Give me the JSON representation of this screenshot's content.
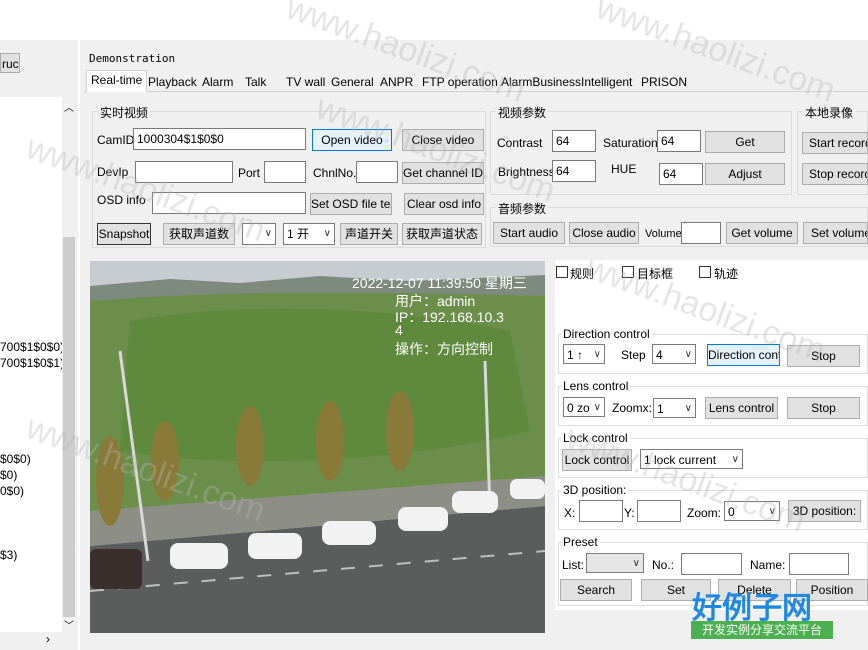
{
  "left_panel": {
    "top_button": "ruc",
    "list_items": [
      "700$1$0$0)",
      "700$1$0$1)",
      "$0$0)",
      "$0)",
      "0$0)",
      "$3)"
    ]
  },
  "window_title": "Demonstration",
  "tabs": [
    "Real-time",
    "Playback",
    "Alarm",
    "Talk",
    "TV wall",
    "General",
    "ANPR",
    "FTP operation",
    "AlarmBusiness",
    "Intelligent",
    "PRISON"
  ],
  "realtime": {
    "group_title": "实时视频",
    "camid_label": "CamID",
    "camid_value": "1000304$1$0$0",
    "open_video": "Open video",
    "close_video": "Close video",
    "devip_label": "DevIp",
    "port_label": "Port",
    "chnlno_label": "ChnlNo.",
    "get_channel": "Get channel ID",
    "osd_label": "OSD info",
    "set_osd": "Set OSD file text",
    "clear_osd": "Clear osd info",
    "snapshot": "Snapshot",
    "get_channels_btn": "获取声道数",
    "channel_select": "1 开",
    "channel_switch": "声道开关",
    "channel_status": "获取声道状态"
  },
  "video_params": {
    "group_title": "视频参数",
    "contrast_label": "Contrast",
    "contrast_value": "64",
    "saturation_label": "Saturation",
    "saturation_value": "64",
    "get_btn": "Get",
    "brightness_label": "Brightness",
    "brightness_value": "64",
    "hue_label": "HUE",
    "hue_value": "64",
    "adjust_btn": "Adjust"
  },
  "local_record": {
    "group_title": "本地录像",
    "start_record": "Start record",
    "stop_record": "Stop record"
  },
  "audio_params": {
    "group_title": "音频参数",
    "start_audio": "Start audio",
    "close_audio": "Close audio",
    "volume_label": "Volume",
    "get_volume": "Get volume",
    "set_volume": "Set volume"
  },
  "video_overlay": {
    "timestamp": "2022-12-07 11:39:50 星期三",
    "user": "用户：admin",
    "ip": "IP：192.168.10.3",
    "num": "4",
    "op": "操作：方向控制"
  },
  "checkboxes": [
    "规则",
    "目标框",
    "轨迹"
  ],
  "direction": {
    "group_title": "Direction control",
    "dir_select": "1 ↑",
    "step_label": "Step",
    "step_value": "4",
    "direction_btn": "Direction control",
    "stop_btn": "Stop"
  },
  "lens": {
    "group_title": "Lens control",
    "zoom_select": "0 zo",
    "zoomx_label": "Zoomx:",
    "zoomx_value": "1",
    "lens_btn": "Lens control",
    "stop_btn": "Stop"
  },
  "lock": {
    "group_title": "Lock control",
    "lock_btn": "Lock control",
    "lock_select": "1 lock current"
  },
  "position3d": {
    "group_title": "3D position:",
    "x_label": "X:",
    "y_label": "Y:",
    "zoom_label": "Zoom:",
    "zoom_value": "0",
    "pos_btn": "3D position:"
  },
  "preset": {
    "group_title": "Preset",
    "list_label": "List:",
    "no_label": "No.:",
    "name_label": "Name:",
    "search_btn": "Search",
    "set_btn": "Set",
    "delete_btn": "Delete",
    "position_btn": "Position"
  },
  "watermark": {
    "site": "www.haolizi.com",
    "brand": "好例子网",
    "slogan": "开发实例分享交流平台"
  },
  "colors": {
    "accent": "#0078d7",
    "panel_bg": "#f0f0f0",
    "brand_blue": "#1e88e5"
  }
}
